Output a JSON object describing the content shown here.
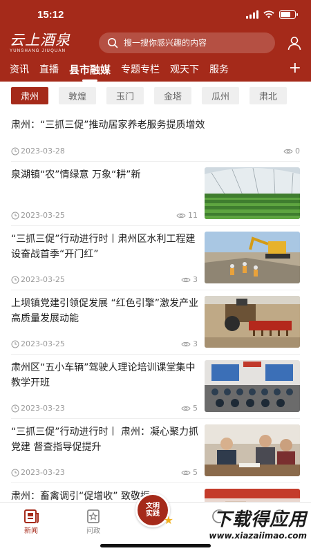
{
  "status_bar": {
    "time": "15:12",
    "battery_percent": 0.7
  },
  "brand": {
    "name": "云上酒泉",
    "sub": "YUNSHANG JIUQUAN"
  },
  "search": {
    "placeholder": "搜一搜你感兴趣的内容"
  },
  "nav": {
    "tabs": [
      "资讯",
      "直播",
      "县市融媒",
      "专题专栏",
      "观天下",
      "服务"
    ],
    "active_index": 2,
    "more_label": "+"
  },
  "subtabs": {
    "items": [
      "肃州",
      "敦煌",
      "玉门",
      "金塔",
      "瓜州",
      "肃北"
    ],
    "active_index": 0
  },
  "news": [
    {
      "title": "肃州：“三抓三促”推动居家养老服务提质增效",
      "date": "2023-03-28",
      "views": "0",
      "thumb": null
    },
    {
      "title": "泉湖镇“农”情绿意 万象“耕”新",
      "date": "2023-03-25",
      "views": "11",
      "thumb": "greenhouse"
    },
    {
      "title": "“三抓三促”行动进行时丨肃州区水利工程建设奋战首季“开门红”",
      "date": "2023-03-25",
      "views": "3",
      "thumb": "construction"
    },
    {
      "title": "上坝镇党建引领促发展 “红色引擎”激发产业高质量发展动能",
      "date": "2023-03-25",
      "views": "3",
      "thumb": "tractor"
    },
    {
      "title": "肃州区“五小车辆”驾驶人理论培训课堂集中教学开班",
      "date": "2023-03-23",
      "views": "5",
      "thumb": "classroom"
    },
    {
      "title": "“三抓三促”行动进行时丨 肃州：凝心聚力抓党建 督查指导促提升",
      "date": "2023-03-23",
      "views": "5",
      "thumb": "meeting"
    },
    {
      "title": "肃州：畜禽调引“促增收” 致敬振",
      "date": "",
      "views": "",
      "thumb": "partial"
    }
  ],
  "tabbar": {
    "news_label": "新闻",
    "politics_label": "问政",
    "center_line1": "文明",
    "center_line2": "实践"
  },
  "watermark": {
    "main": "下载得应用",
    "url": "www.xiazaiimao.com"
  },
  "colors": {
    "brand_red": "#a52a1a",
    "accent_gold": "#f2b01e"
  }
}
